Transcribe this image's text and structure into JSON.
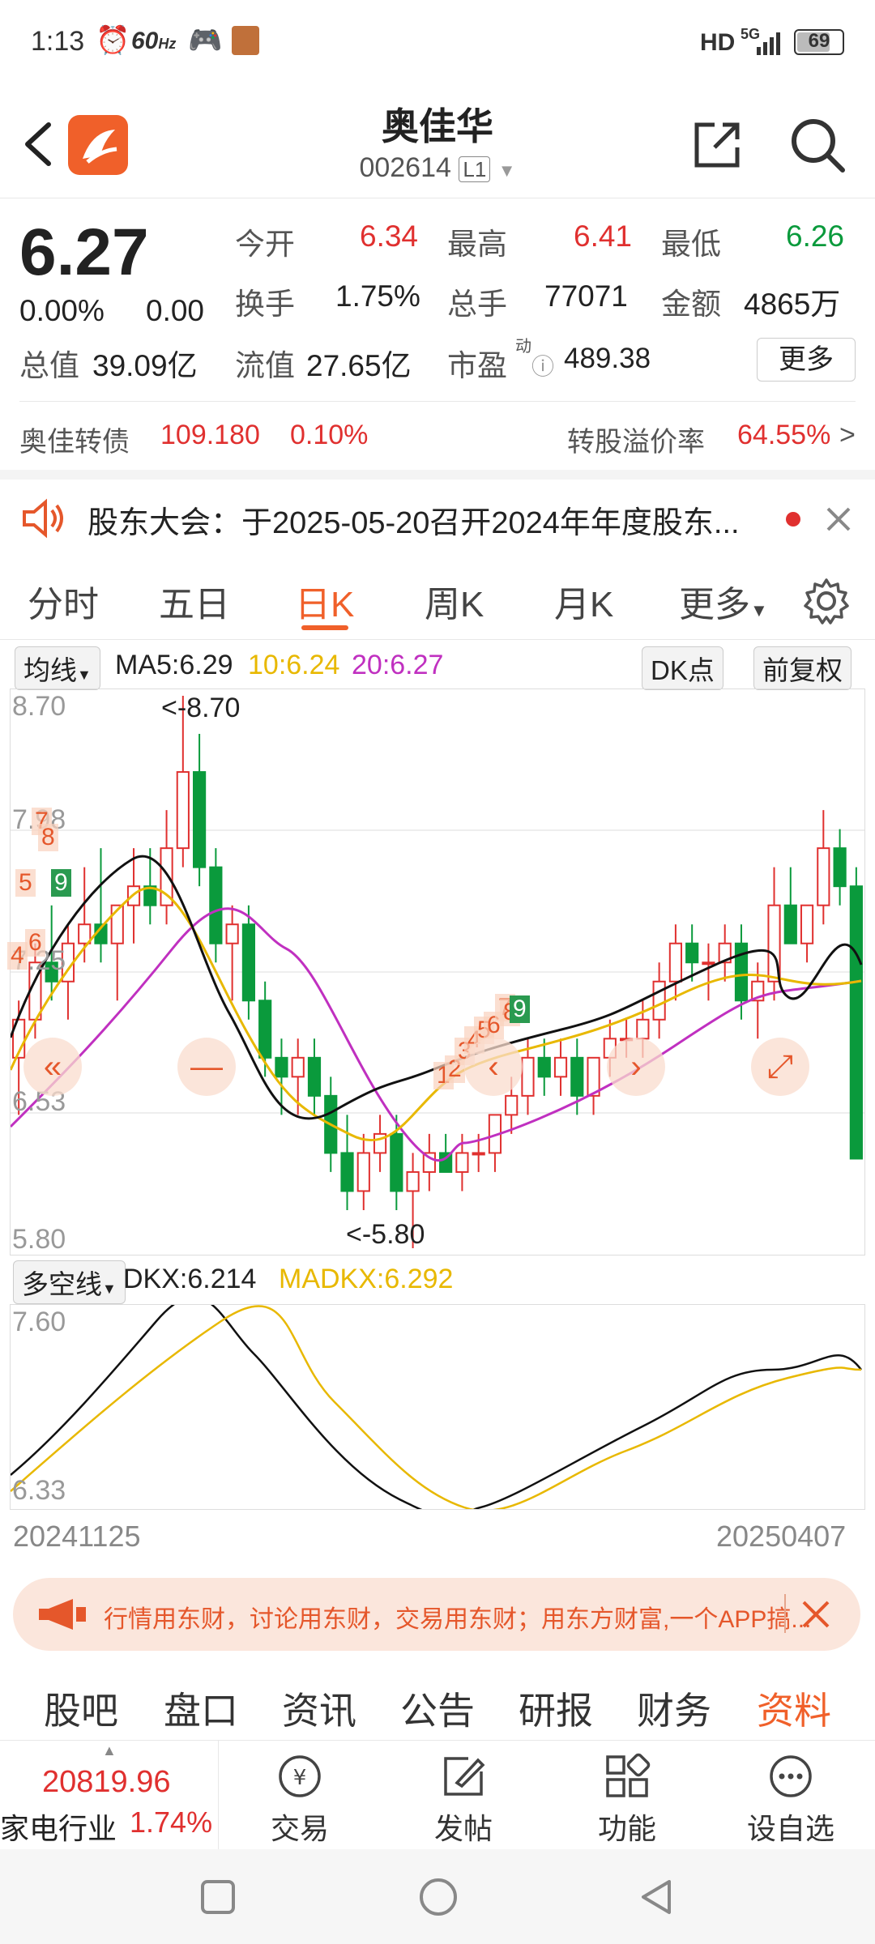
{
  "status": {
    "time": "1:13",
    "refresh": "60",
    "refresh_unit": "Hz",
    "hd": "HD",
    "network": "5G",
    "battery": "69"
  },
  "header": {
    "name": "奥佳华",
    "code": "002614",
    "level": "L1"
  },
  "quote": {
    "price": "6.27",
    "change_pct": "0.00%",
    "change": "0.00",
    "open_label": "今开",
    "open": "6.34",
    "high_label": "最高",
    "high": "6.41",
    "low_label": "最低",
    "low": "6.26",
    "turnover_label": "换手",
    "turnover": "1.75%",
    "volume_label": "总手",
    "volume": "77071",
    "amount_label": "金额",
    "amount": "4865万",
    "mktcap_label": "总值",
    "mktcap": "39.09亿",
    "float_label": "流值",
    "float": "27.65亿",
    "pe_label": "市盈",
    "pe_sup": "动",
    "pe": "489.38",
    "more": "更多"
  },
  "bond": {
    "name": "奥佳转债",
    "price": "109.180",
    "pct": "0.10%",
    "premium_label": "转股溢价率",
    "premium": "64.55%",
    "arrow": ">"
  },
  "notice": {
    "text": "股东大会：于2025-05-20召开2024年年度股东..."
  },
  "tabs": [
    "分时",
    "五日",
    "日K",
    "周K",
    "月K",
    "更多"
  ],
  "active_tab": 2,
  "kchart": {
    "indicator_label": "均线",
    "ma5": "MA5:6.29",
    "ma10": "10:6.24",
    "ma20": "20:6.27",
    "dk_button": "DK点",
    "adjust_button": "前复权",
    "y_top": "8.70",
    "y_mid_high": "7.98",
    "y_mid": "7.25",
    "y_mid_low": "6.53",
    "y_bottom": "5.80",
    "high_marker": "<-8.70",
    "low_marker": "<-5.80",
    "td_up": [
      "1",
      "2",
      "3",
      "4",
      "5",
      "6",
      "7",
      "8",
      "9"
    ],
    "td_down_left": [
      "4",
      "5",
      "6",
      "7",
      "8",
      "9"
    ]
  },
  "dkx": {
    "label": "多空线",
    "dkx": "DKX:6.214",
    "madkx": "MADKX:6.292",
    "y_top": "7.60",
    "y_bottom": "6.33",
    "date_start": "20241125",
    "date_end": "20250407"
  },
  "chart_data": {
    "type": "candlestick",
    "ylim": [
      5.8,
      8.7
    ],
    "ohlc": [
      [
        6.8,
        7.1,
        6.5,
        7.0
      ],
      [
        7.0,
        7.4,
        6.9,
        7.3
      ],
      [
        7.3,
        7.6,
        7.1,
        7.2
      ],
      [
        7.2,
        7.5,
        7.0,
        7.4
      ],
      [
        7.4,
        7.8,
        7.3,
        7.5
      ],
      [
        7.5,
        7.9,
        7.3,
        7.4
      ],
      [
        7.4,
        7.6,
        7.1,
        7.6
      ],
      [
        7.6,
        7.9,
        7.4,
        7.7
      ],
      [
        7.7,
        7.9,
        7.5,
        7.6
      ],
      [
        7.6,
        8.1,
        7.5,
        7.9
      ],
      [
        7.9,
        8.7,
        7.8,
        8.3
      ],
      [
        8.3,
        8.5,
        7.7,
        7.8
      ],
      [
        7.8,
        7.9,
        7.3,
        7.4
      ],
      [
        7.4,
        7.6,
        7.1,
        7.5
      ],
      [
        7.5,
        7.6,
        7.0,
        7.1
      ],
      [
        7.1,
        7.2,
        6.7,
        6.8
      ],
      [
        6.8,
        6.9,
        6.5,
        6.7
      ],
      [
        6.7,
        6.9,
        6.5,
        6.8
      ],
      [
        6.8,
        6.9,
        6.5,
        6.6
      ],
      [
        6.6,
        6.7,
        6.2,
        6.3
      ],
      [
        6.3,
        6.5,
        6.0,
        6.1
      ],
      [
        6.1,
        6.4,
        6.0,
        6.3
      ],
      [
        6.3,
        6.5,
        6.2,
        6.4
      ],
      [
        6.4,
        6.5,
        6.0,
        6.1
      ],
      [
        6.1,
        6.3,
        5.8,
        6.2
      ],
      [
        6.2,
        6.4,
        6.1,
        6.3
      ],
      [
        6.3,
        6.4,
        6.2,
        6.2
      ],
      [
        6.2,
        6.4,
        6.1,
        6.3
      ],
      [
        6.3,
        6.4,
        6.2,
        6.3
      ],
      [
        6.3,
        6.5,
        6.2,
        6.5
      ],
      [
        6.5,
        6.7,
        6.4,
        6.6
      ],
      [
        6.6,
        6.9,
        6.5,
        6.8
      ],
      [
        6.8,
        6.9,
        6.6,
        6.7
      ],
      [
        6.7,
        6.9,
        6.6,
        6.8
      ],
      [
        6.8,
        6.9,
        6.5,
        6.6
      ],
      [
        6.6,
        6.8,
        6.5,
        6.8
      ],
      [
        6.8,
        7.0,
        6.7,
        6.9
      ],
      [
        6.9,
        7.0,
        6.8,
        6.9
      ],
      [
        6.9,
        7.1,
        6.8,
        7.0
      ],
      [
        7.0,
        7.3,
        6.9,
        7.2
      ],
      [
        7.2,
        7.5,
        7.1,
        7.4
      ],
      [
        7.4,
        7.5,
        7.2,
        7.3
      ],
      [
        7.3,
        7.4,
        7.1,
        7.3
      ],
      [
        7.3,
        7.5,
        7.2,
        7.4
      ],
      [
        7.4,
        7.5,
        7.0,
        7.1
      ],
      [
        7.1,
        7.3,
        6.9,
        7.2
      ],
      [
        7.2,
        7.8,
        7.1,
        7.6
      ],
      [
        7.6,
        7.8,
        7.5,
        7.4
      ],
      [
        7.4,
        7.6,
        7.3,
        7.6
      ],
      [
        7.6,
        8.1,
        7.5,
        7.9
      ],
      [
        7.9,
        8.0,
        7.6,
        7.7
      ],
      [
        7.7,
        7.8,
        7.5,
        6.27
      ]
    ]
  }
}
